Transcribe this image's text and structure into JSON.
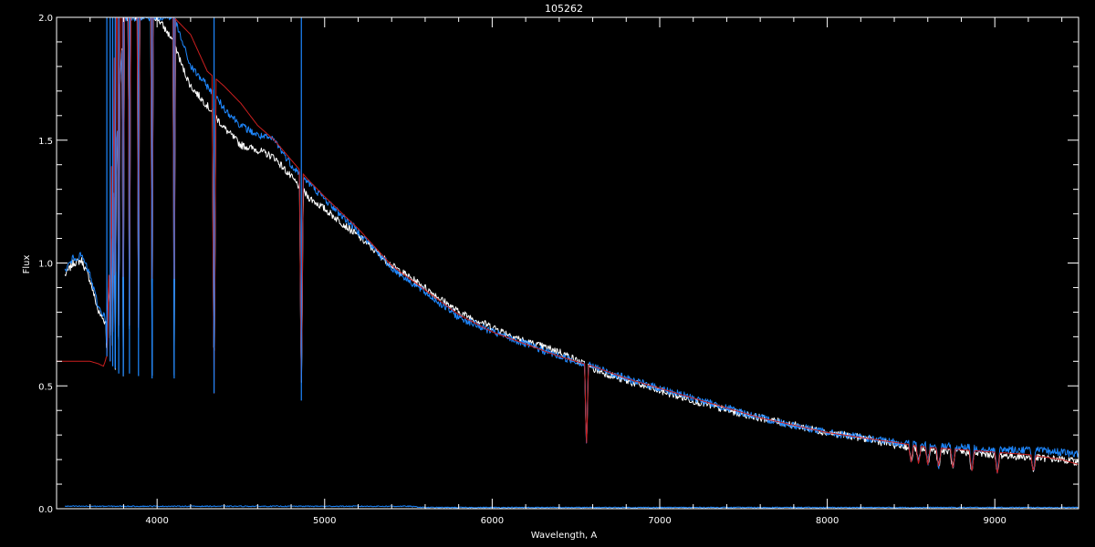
{
  "chart_data": {
    "type": "line",
    "title": "105262",
    "xlabel": "Wavelength, A",
    "ylabel": "Flux",
    "xlim": [
      3400,
      9500
    ],
    "ylim": [
      0.0,
      2.0
    ],
    "x_ticks": [
      4000,
      5000,
      6000,
      7000,
      8000,
      9000
    ],
    "y_ticks": [
      0.0,
      0.5,
      1.0,
      1.5,
      2.0
    ],
    "x_tick_labels": [
      "4000",
      "5000",
      "6000",
      "7000",
      "8000",
      "9000"
    ],
    "y_tick_labels": [
      "0.0",
      "0.5",
      "1.0",
      "1.5",
      "2.0"
    ],
    "grid": false,
    "colors": {
      "background": "#000000",
      "axes": "#ffffff",
      "observed": "#ffffff",
      "corrected": "#1e88ff",
      "model": "#cc1f1f",
      "error": "#1e88ff"
    },
    "series": [
      {
        "key": "observed",
        "x": [
          3450,
          3500,
          3550,
          3600,
          3650,
          3700,
          3800,
          3900,
          4000,
          4100,
          4150,
          4200,
          4300,
          4400,
          4500,
          4600,
          4700,
          4800,
          4900,
          5000,
          5200,
          5400,
          5600,
          5800,
          6000,
          6200,
          6400,
          6600,
          6800,
          7000,
          7200,
          7400,
          7600,
          7800,
          8000,
          8200,
          8400,
          8600,
          8800,
          9000,
          9200,
          9400,
          9500
        ],
        "y": [
          0.95,
          1.0,
          1.01,
          0.93,
          0.8,
          0.75,
          2.0,
          2.0,
          2.0,
          1.9,
          1.8,
          1.72,
          1.64,
          1.55,
          1.48,
          1.46,
          1.43,
          1.35,
          1.27,
          1.22,
          1.11,
          0.99,
          0.9,
          0.8,
          0.74,
          0.68,
          0.64,
          0.57,
          0.52,
          0.48,
          0.44,
          0.4,
          0.37,
          0.34,
          0.31,
          0.29,
          0.26,
          0.24,
          0.23,
          0.22,
          0.21,
          0.2,
          0.19
        ]
      },
      {
        "key": "corrected",
        "x": [
          3450,
          3500,
          3550,
          3600,
          3650,
          3700,
          3800,
          3900,
          4000,
          4100,
          4150,
          4200,
          4300,
          4400,
          4500,
          4600,
          4700,
          4800,
          4900,
          5000,
          5200,
          5400,
          5600,
          5800,
          6000,
          6200,
          6400,
          6600,
          6800,
          7000,
          7200,
          7400,
          7600,
          7800,
          8000,
          8200,
          8400,
          8600,
          8800,
          9000,
          9200,
          9400,
          9500
        ],
        "y": [
          0.97,
          1.02,
          1.03,
          0.95,
          0.82,
          0.77,
          2.0,
          2.0,
          2.0,
          2.0,
          1.9,
          1.8,
          1.72,
          1.63,
          1.56,
          1.52,
          1.5,
          1.4,
          1.33,
          1.26,
          1.13,
          0.98,
          0.88,
          0.78,
          0.72,
          0.67,
          0.62,
          0.58,
          0.53,
          0.49,
          0.45,
          0.41,
          0.37,
          0.34,
          0.31,
          0.29,
          0.27,
          0.26,
          0.25,
          0.24,
          0.24,
          0.23,
          0.22
        ]
      },
      {
        "key": "model",
        "x": [
          3400,
          3500,
          3600,
          3650,
          3680,
          3700,
          3750,
          3800,
          3900,
          4000,
          4100,
          4200,
          4300,
          4400,
          4500,
          4600,
          4700,
          4800,
          4900,
          5000,
          5200,
          5400,
          5600,
          5800,
          6000,
          6200,
          6400,
          6600,
          6800,
          7000,
          7200,
          7400,
          7600,
          7800,
          8000,
          8200,
          8400,
          8600,
          8800,
          9000,
          9200,
          9400,
          9500
        ],
        "y": [
          0.6,
          0.6,
          0.6,
          0.59,
          0.58,
          0.62,
          2.0,
          2.0,
          2.0,
          2.0,
          2.0,
          1.93,
          1.78,
          1.72,
          1.65,
          1.56,
          1.5,
          1.42,
          1.34,
          1.27,
          1.14,
          0.99,
          0.89,
          0.79,
          0.72,
          0.67,
          0.62,
          0.58,
          0.53,
          0.49,
          0.45,
          0.41,
          0.37,
          0.34,
          0.31,
          0.29,
          0.27,
          0.25,
          0.24,
          0.23,
          0.22,
          0.2,
          0.18
        ]
      },
      {
        "key": "error",
        "x": [
          3450,
          4000,
          4500,
          5000,
          5500,
          5600,
          9500
        ],
        "y": [
          0.01,
          0.01,
          0.01,
          0.01,
          0.01,
          0.005,
          0.005
        ]
      }
    ],
    "absorption_lines": [
      {
        "x": 3700,
        "depth_to": 0.62
      },
      {
        "x": 3720,
        "depth_to": 0.6
      },
      {
        "x": 3735,
        "depth_to": 0.58
      },
      {
        "x": 3750,
        "depth_to": 0.57
      },
      {
        "x": 3771,
        "depth_to": 0.55
      },
      {
        "x": 3798,
        "depth_to": 0.54
      },
      {
        "x": 3835,
        "depth_to": 0.55
      },
      {
        "x": 3889,
        "depth_to": 0.54
      },
      {
        "x": 3970,
        "depth_to": 0.53
      },
      {
        "x": 4102,
        "depth_to": 0.53
      },
      {
        "x": 4340,
        "depth_to": 0.47
      },
      {
        "x": 4861,
        "depth_to": 0.44
      },
      {
        "x": 6563,
        "depth_to": 0.24
      },
      {
        "x": 8500,
        "depth_to": 0.19
      },
      {
        "x": 8545,
        "depth_to": 0.18
      },
      {
        "x": 8600,
        "depth_to": 0.18
      },
      {
        "x": 8665,
        "depth_to": 0.17
      },
      {
        "x": 8750,
        "depth_to": 0.16
      },
      {
        "x": 8863,
        "depth_to": 0.15
      },
      {
        "x": 9015,
        "depth_to": 0.14
      },
      {
        "x": 9230,
        "depth_to": 0.15
      }
    ]
  }
}
